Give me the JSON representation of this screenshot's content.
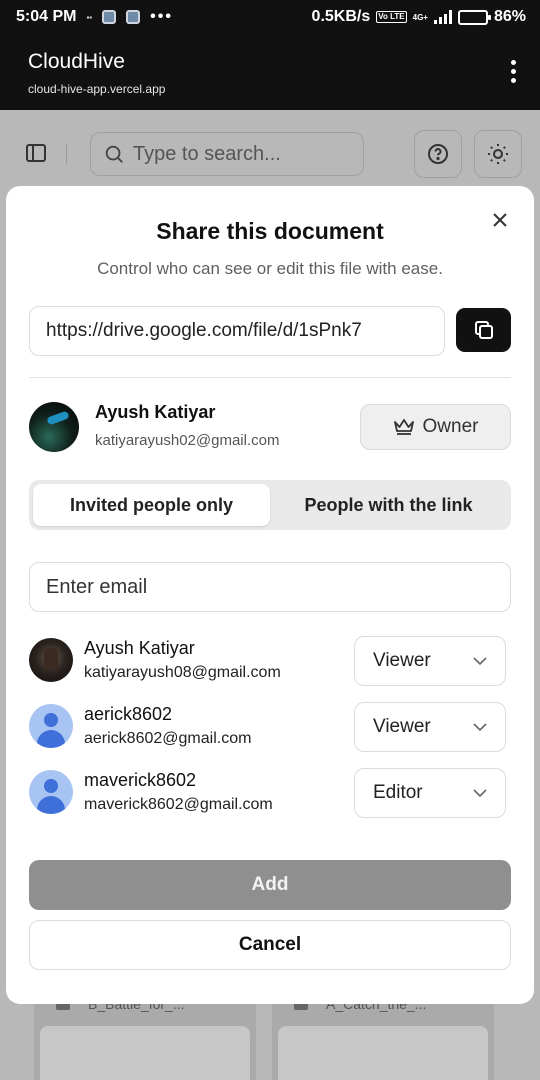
{
  "status_bar": {
    "time": "5:04 PM",
    "network_speed": "0.5KB/s",
    "volte": "Vo LTE",
    "network_type": "4G+",
    "battery": "86%",
    "battery_level": 0.86
  },
  "app_bar": {
    "title": "CloudHive",
    "url": "cloud-hive-app.vercel.app"
  },
  "background": {
    "search_placeholder": "Type to search...",
    "cards": [
      "B_Battle_for_...",
      "A_Catch_the_..."
    ]
  },
  "share_modal": {
    "title": "Share this document",
    "subtitle": "Control who can see or edit this file with ease.",
    "link": "https://drive.google.com/file/d/1sPnk7",
    "owner": {
      "name": "Ayush Katiyar",
      "email": "katiyarayush02@gmail.com",
      "badge": "Owner"
    },
    "access_tabs": [
      {
        "label": "Invited people only",
        "active": true
      },
      {
        "label": "People with the link",
        "active": false
      }
    ],
    "email_placeholder": "Enter email",
    "people": [
      {
        "name": "Ayush Katiyar",
        "email": "katiyarayush08@gmail.com",
        "role": "Viewer",
        "avatar": "photo"
      },
      {
        "name": "aerick8602",
        "email": "aerick8602@gmail.com",
        "role": "Viewer",
        "avatar": "generic-user-icon"
      },
      {
        "name": "maverick8602",
        "email": "maverick8602@gmail.com",
        "role": "Editor",
        "avatar": "generic-user-icon"
      }
    ],
    "add_label": "Add",
    "cancel_label": "Cancel"
  },
  "colors": {
    "primary_button_disabled": "#8f8f8f",
    "copy_button": "#111111",
    "avatar_generic_bg": "#a8c4f2",
    "avatar_generic_fg": "#3f6fd9",
    "battery": "#f1a81b"
  }
}
